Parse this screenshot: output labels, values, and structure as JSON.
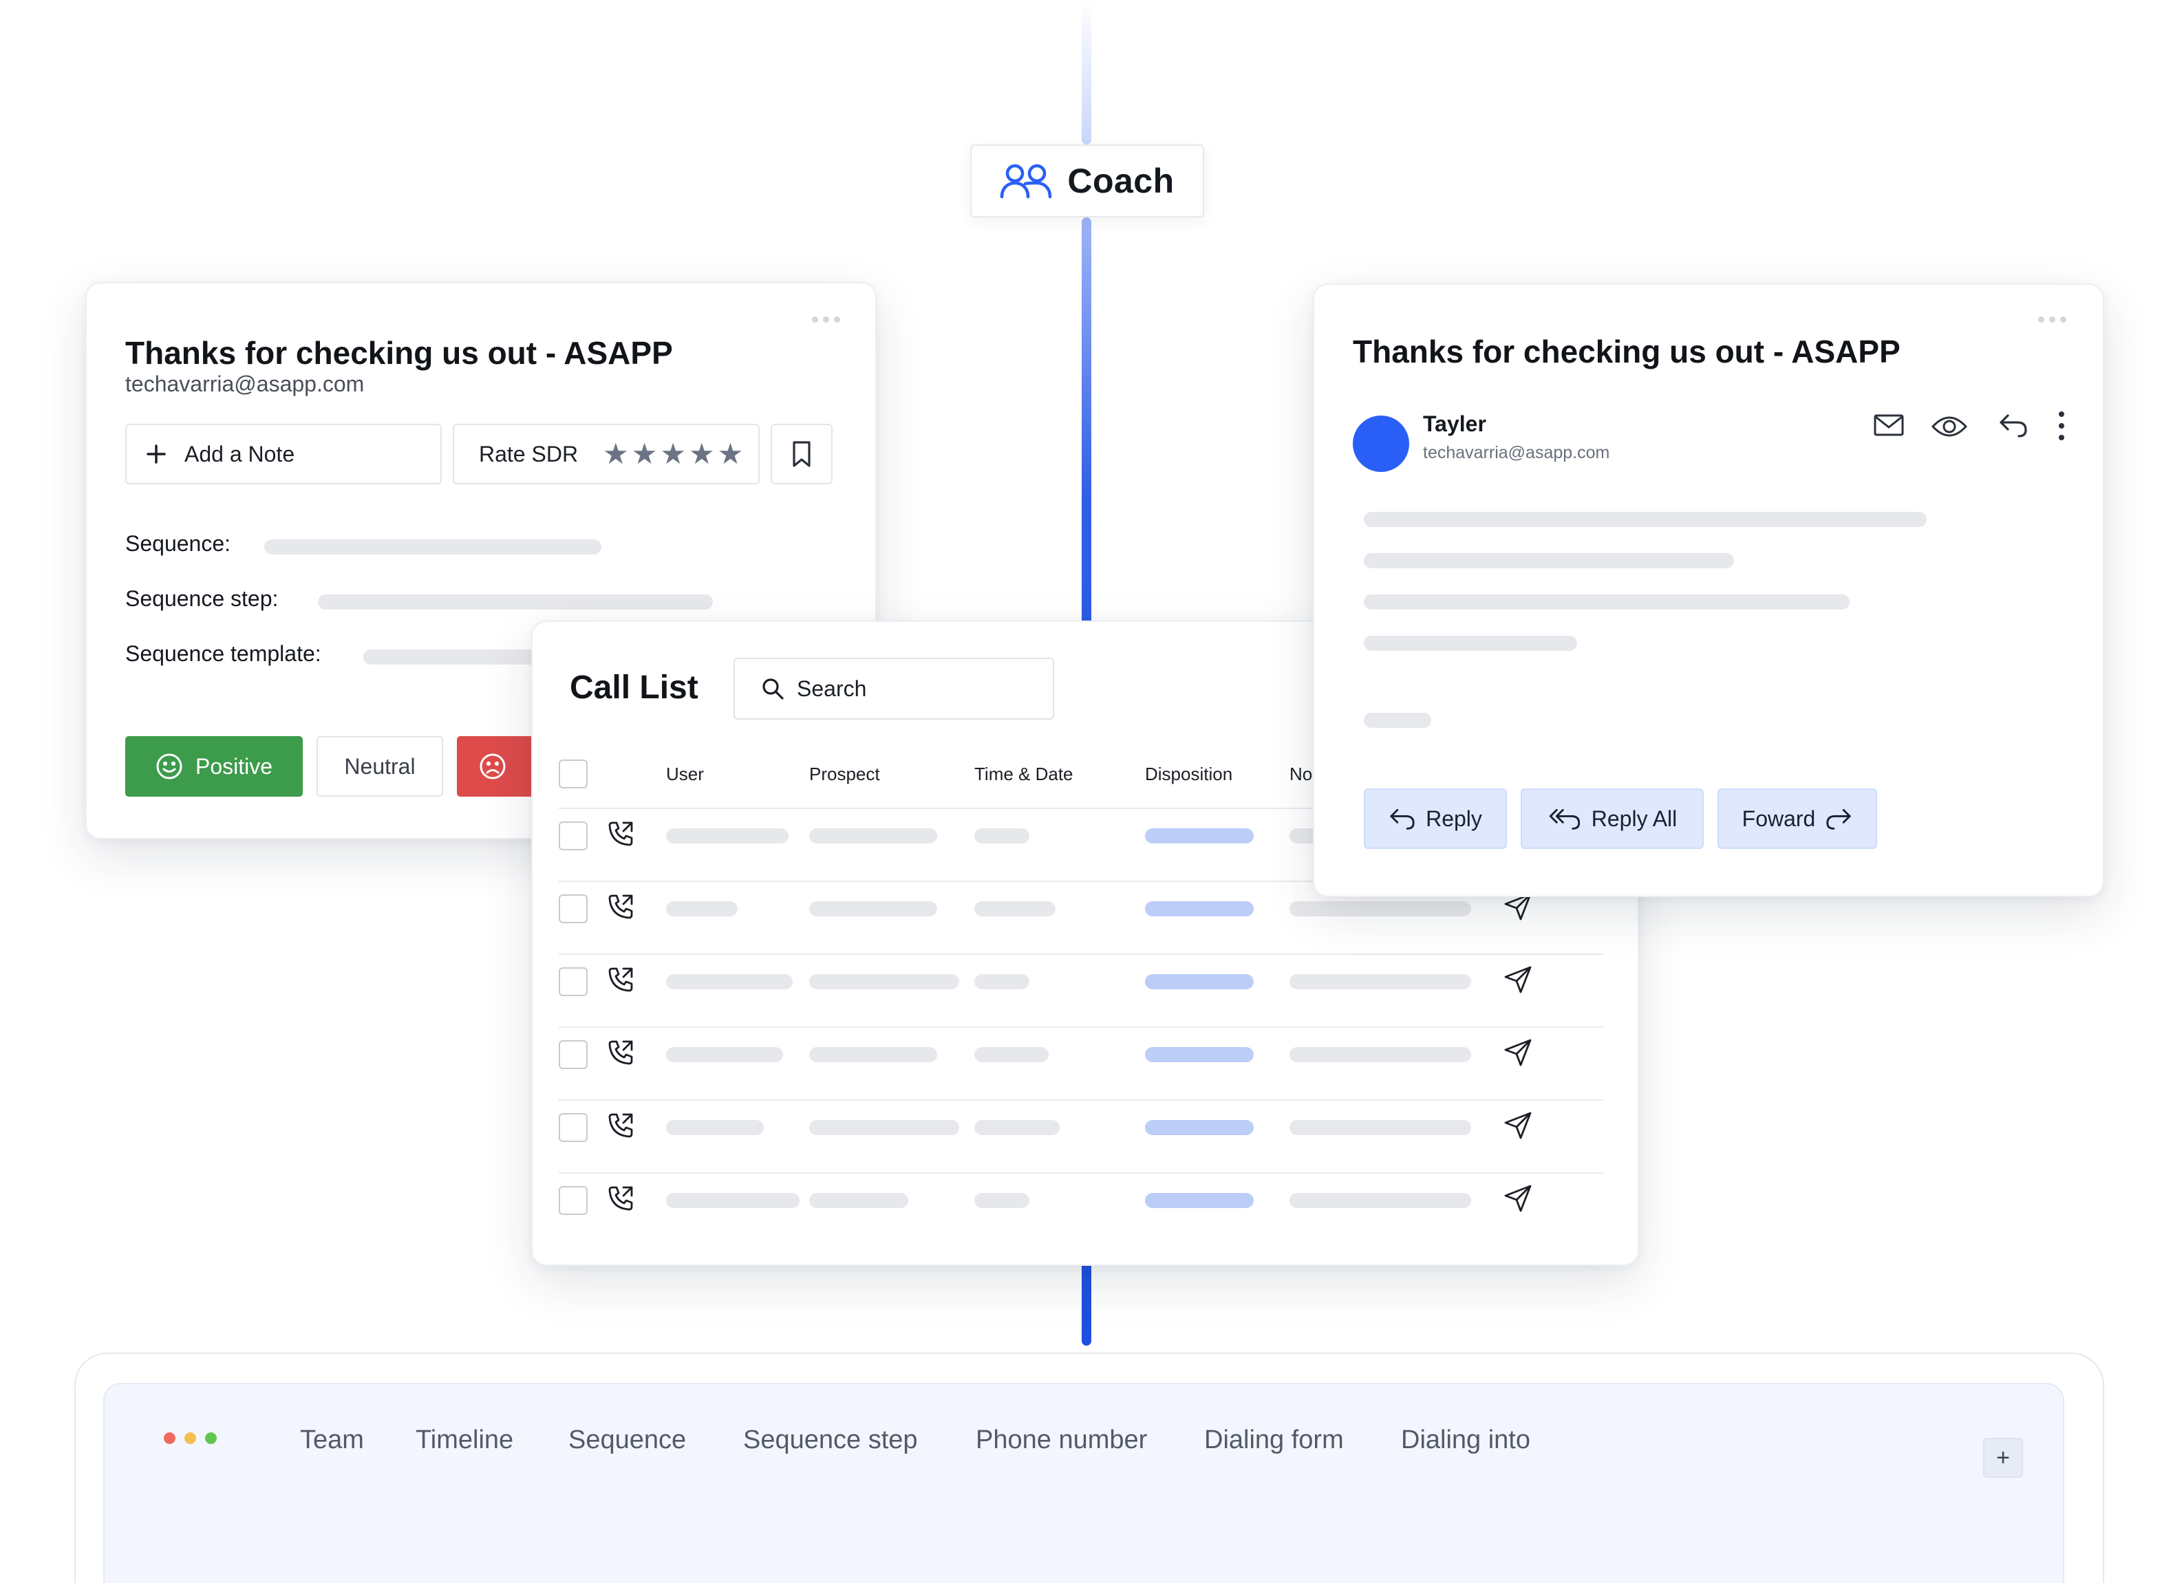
{
  "coach": {
    "label": "Coach",
    "icon": "users-icon"
  },
  "left_card": {
    "title": "Thanks for checking us out - ASAPP",
    "email": "techavarria@asapp.com",
    "add_note_label": "Add a Note",
    "rate_label": "Rate SDR",
    "rating_stars": 5,
    "fields": {
      "sequence": "Sequence:",
      "sequence_step": "Sequence step:",
      "sequence_template": "Sequence template:"
    },
    "sentiment": {
      "positive": "Positive",
      "neutral": "Neutral"
    },
    "colors": {
      "positive": "#3d9b4c",
      "negative": "#dd4b4b"
    }
  },
  "email_card": {
    "title": "Thanks for checking us out - ASAPP",
    "sender_name": "Tayler",
    "sender_email": "techavarria@asapp.com",
    "actions": {
      "reply": "Reply",
      "reply_all": "Reply All",
      "forward": "Foward"
    },
    "accent": "#2a5ff7"
  },
  "call_list": {
    "title": "Call List",
    "search_placeholder": "Search",
    "columns": {
      "user": "User",
      "prospect": "Prospect",
      "time_date": "Time & Date",
      "disposition": "Disposition",
      "notes": "No"
    },
    "row_count": 6
  },
  "bottom_bar": {
    "tabs": [
      "Team",
      "Timeline",
      "Sequence",
      "Sequence step",
      "Phone number",
      "Dialing form",
      "Dialing into"
    ],
    "add_label": "+",
    "window_dot_colors": [
      "#ee6a5f",
      "#f4bf4f",
      "#61c554"
    ]
  }
}
